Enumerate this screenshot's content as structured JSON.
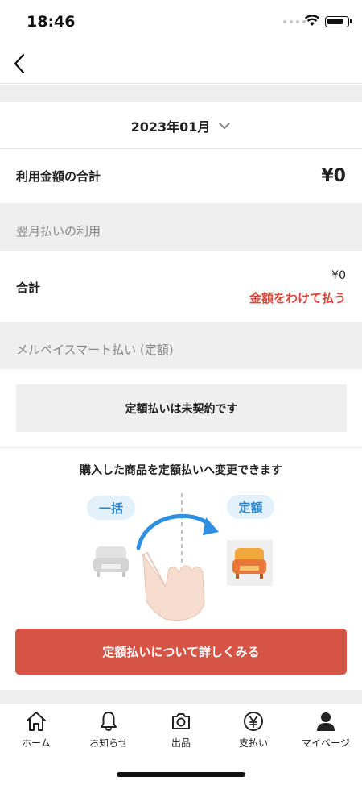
{
  "status_bar": {
    "time": "18:46"
  },
  "month_selector": {
    "label": "2023年01月"
  },
  "total": {
    "label": "利用金額の合計",
    "amount": "¥0"
  },
  "next_month_section": {
    "heading": "翌月払いの利用",
    "sum_label": "合計",
    "sum_amount": "¥0",
    "split_link": "金額をわけて払う"
  },
  "smart_pay_section": {
    "heading": "メルペイスマート払い (定額)",
    "status_text": "定額払いは未契約です",
    "promo_title": "購入した商品を定額払いへ変更できます",
    "pill_lump": "一括",
    "pill_fixed": "定額",
    "cta_label": "定額払いについて詳しくみる"
  },
  "tab_bar": {
    "items": [
      {
        "label": "ホーム",
        "icon": "home-icon"
      },
      {
        "label": "お知らせ",
        "icon": "bell-icon"
      },
      {
        "label": "出品",
        "icon": "camera-icon"
      },
      {
        "label": "支払い",
        "icon": "yen-icon"
      },
      {
        "label": "マイページ",
        "icon": "person-icon"
      }
    ]
  },
  "colors": {
    "accent_red": "#d65446",
    "link_red": "#d9483b",
    "pill_blue": "#2e86c8",
    "section_gray": "#efefef"
  }
}
